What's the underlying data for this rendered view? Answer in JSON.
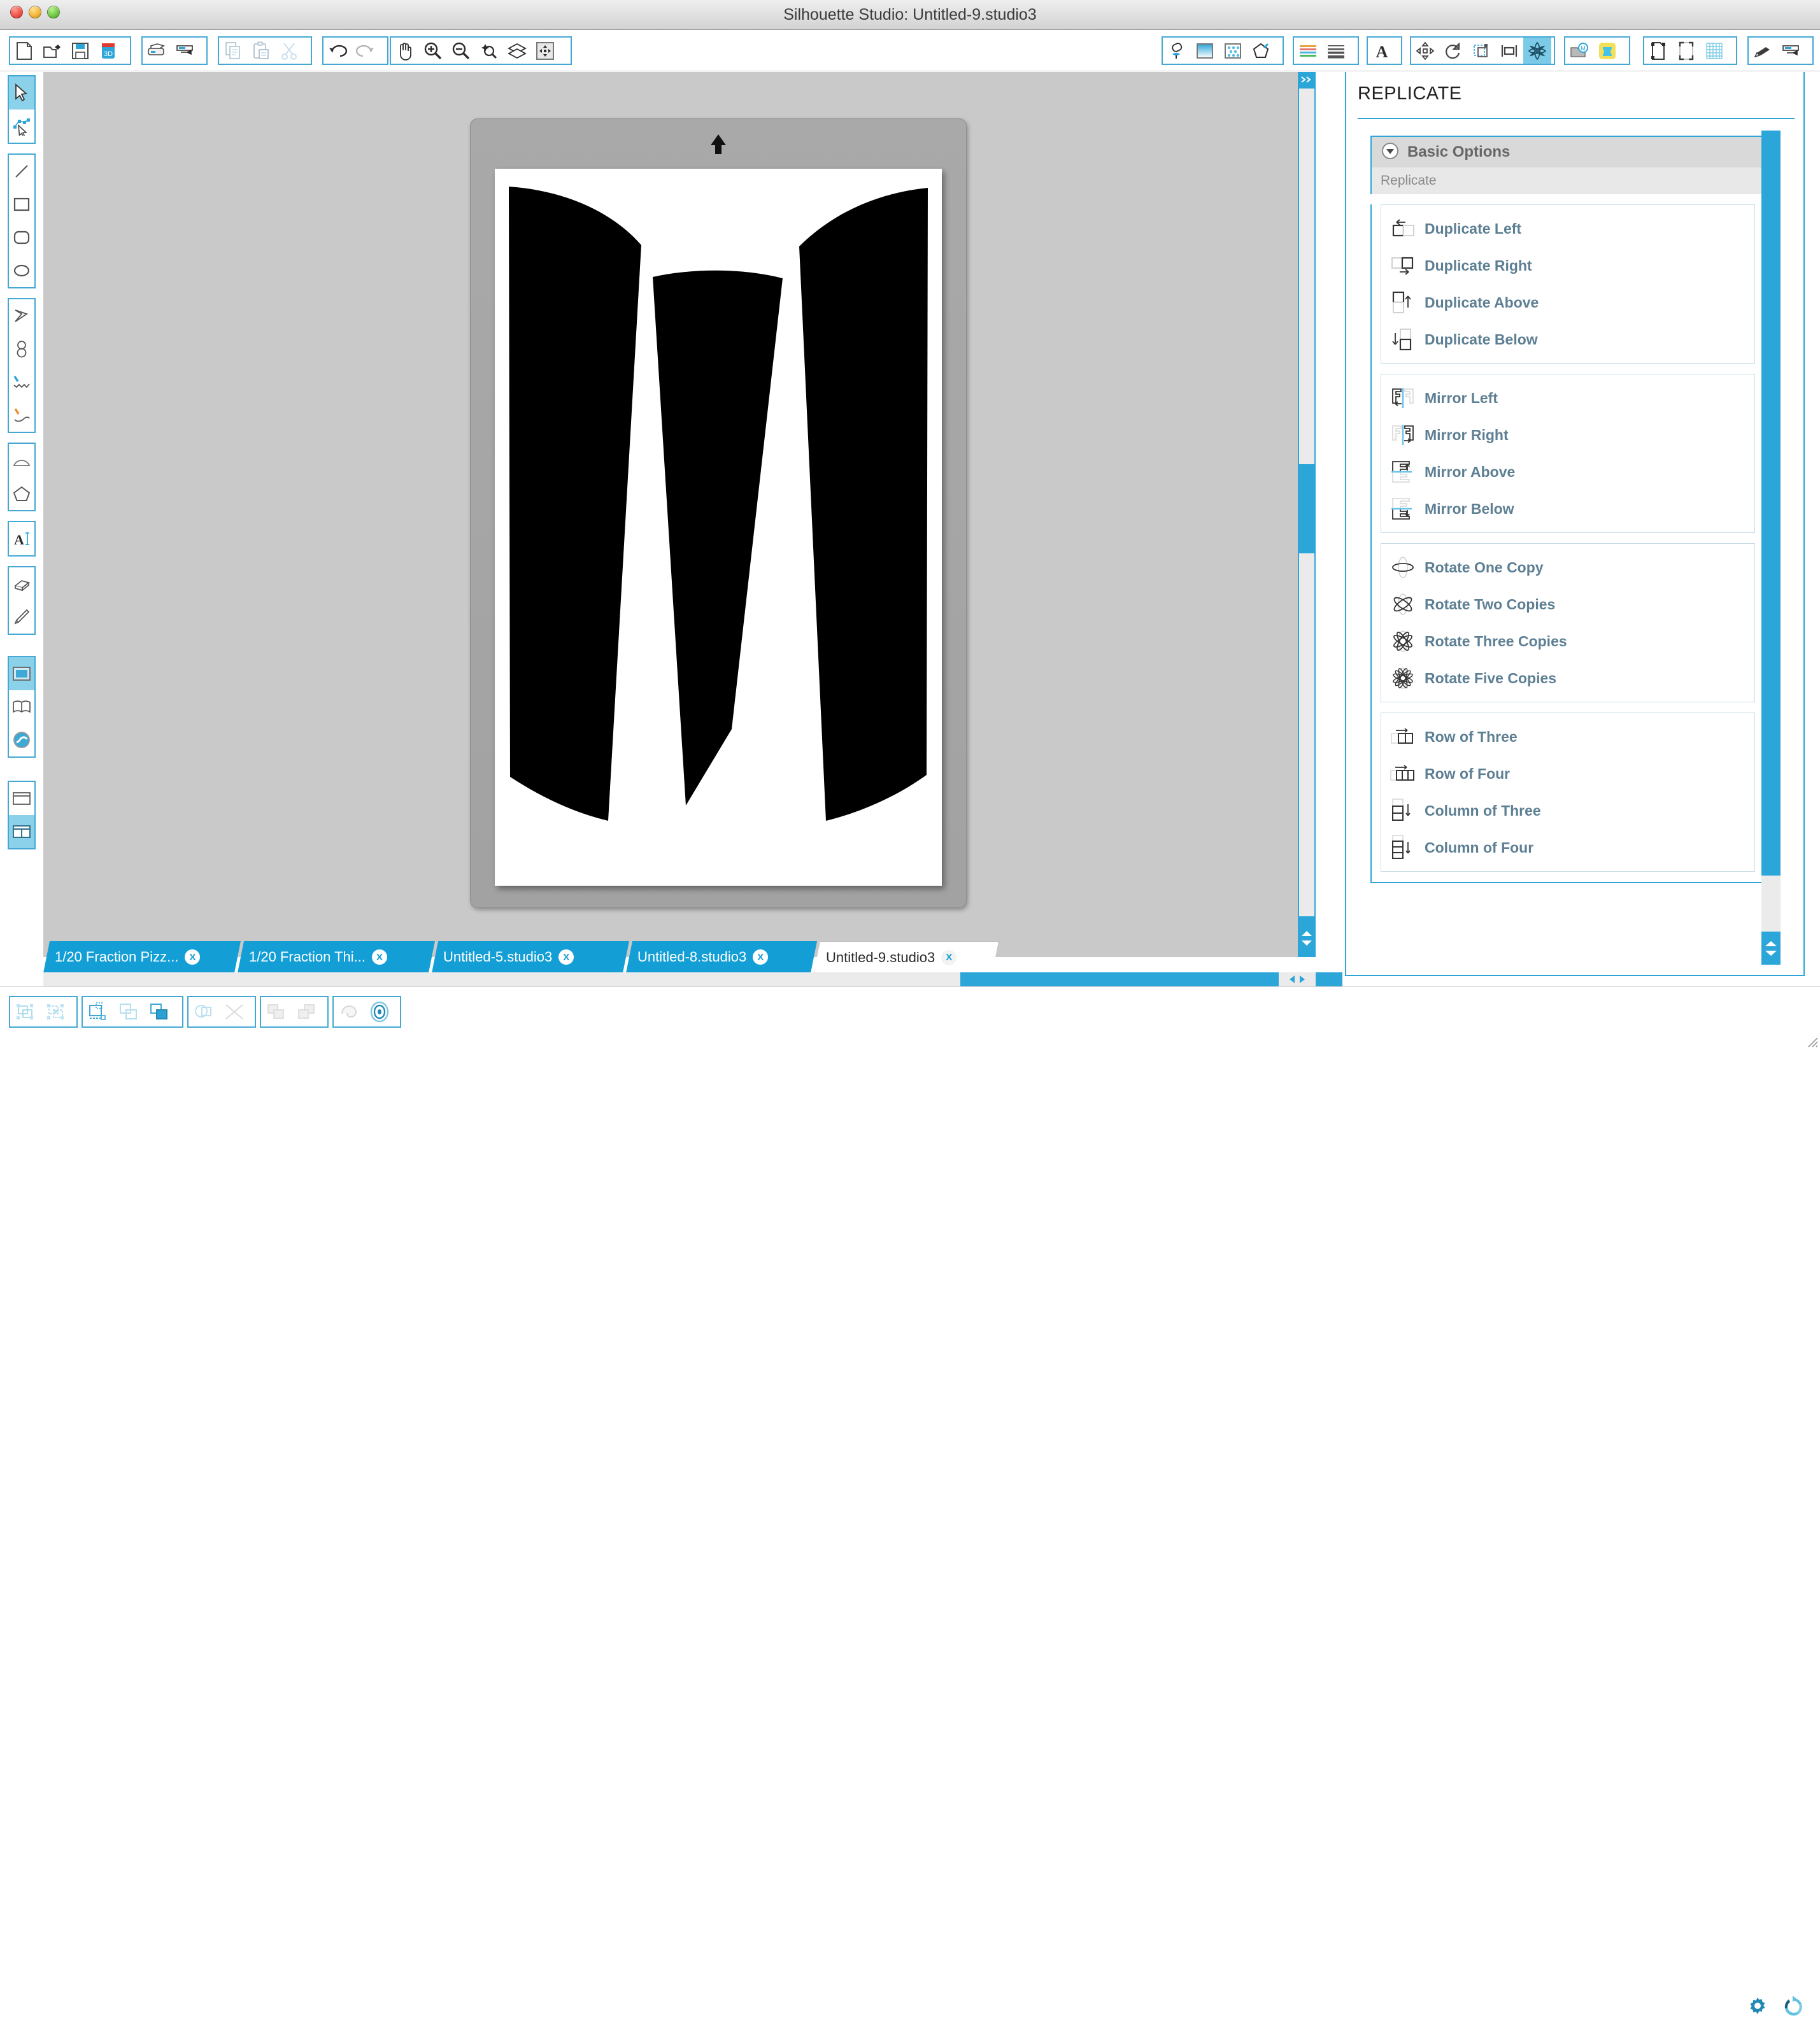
{
  "window": {
    "title": "Silhouette Studio: Untitled-9.studio3",
    "controls": [
      "close",
      "minimize",
      "maximize"
    ]
  },
  "toolbar": {
    "groups": [
      {
        "name": "file",
        "buttons": [
          {
            "icon": "new-document-icon",
            "label": "New"
          },
          {
            "icon": "open-folder-icon",
            "label": "Open"
          },
          {
            "icon": "save-floppy-icon",
            "label": "Save"
          },
          {
            "icon": "save-to-library-icon",
            "label": "Save to Library"
          }
        ]
      },
      {
        "name": "print",
        "buttons": [
          {
            "icon": "printer-icon",
            "label": "Print"
          },
          {
            "icon": "send-to-silhouette-icon",
            "label": "Send to Silhouette"
          }
        ]
      },
      {
        "name": "clipboard",
        "buttons": [
          {
            "icon": "copy-icon",
            "label": "Copy"
          },
          {
            "icon": "paste-icon",
            "label": "Paste"
          },
          {
            "icon": "cut-scissors-icon",
            "label": "Cut"
          }
        ]
      },
      {
        "name": "history",
        "buttons": [
          {
            "icon": "undo-arrow-icon",
            "label": "Undo"
          },
          {
            "icon": "redo-arrow-icon",
            "label": "Redo"
          }
        ]
      },
      {
        "name": "view",
        "buttons": [
          {
            "icon": "pan-hand-icon",
            "label": "Pan"
          },
          {
            "icon": "zoom-in-icon",
            "label": "Zoom In"
          },
          {
            "icon": "zoom-out-icon",
            "label": "Zoom Out"
          },
          {
            "icon": "zoom-selection-icon",
            "label": "Zoom to Selection"
          },
          {
            "icon": "fit-to-page-icon",
            "label": "Fit to Page"
          },
          {
            "icon": "fit-to-window-icon",
            "label": "Fit to Window"
          }
        ]
      }
    ],
    "right_groups": [
      {
        "name": "style",
        "buttons": [
          {
            "icon": "fill-color-icon",
            "label": "Fill Color"
          },
          {
            "icon": "gradient-fill-icon",
            "label": "Gradient Fill"
          },
          {
            "icon": "pattern-fill-icon",
            "label": "Pattern Fill"
          },
          {
            "icon": "line-color-icon",
            "label": "Line Color"
          }
        ]
      },
      {
        "name": "lines",
        "buttons": [
          {
            "icon": "line-style-icon",
            "label": "Line Style"
          },
          {
            "icon": "line-thickness-icon",
            "label": "Line Thickness"
          }
        ]
      },
      {
        "name": "text",
        "buttons": [
          {
            "icon": "text-style-icon",
            "label": "Text Style"
          }
        ]
      },
      {
        "name": "transform",
        "buttons": [
          {
            "icon": "move-icon",
            "label": "Move"
          },
          {
            "icon": "rotate-icon",
            "label": "Rotate"
          },
          {
            "icon": "scale-icon",
            "label": "Scale"
          },
          {
            "icon": "align-icon",
            "label": "Align"
          },
          {
            "icon": "replicate-icon",
            "label": "Replicate",
            "selected": true
          }
        ]
      },
      {
        "name": "library",
        "buttons": [
          {
            "icon": "my-library-icon",
            "label": "My Library"
          },
          {
            "icon": "store-icon",
            "label": "Silhouette Store"
          }
        ]
      },
      {
        "name": "page",
        "buttons": [
          {
            "icon": "page-setup-icon",
            "label": "Page Setup"
          },
          {
            "icon": "registration-marks-icon",
            "label": "Registration Marks"
          },
          {
            "icon": "grid-icon",
            "label": "Grid"
          }
        ]
      },
      {
        "name": "cut",
        "buttons": [
          {
            "icon": "cut-settings-icon",
            "label": "Cut Settings"
          },
          {
            "icon": "send-to-cutter-icon",
            "label": "Send to Silhouette"
          }
        ]
      }
    ]
  },
  "left_rail": {
    "groups": [
      {
        "name": "select",
        "tools": [
          {
            "icon": "select-arrow-icon",
            "label": "Select",
            "selected": true
          },
          {
            "icon": "edit-points-icon",
            "label": "Edit Points"
          }
        ]
      },
      {
        "name": "shapes",
        "tools": [
          {
            "icon": "line-tool-icon",
            "label": "Draw a Line"
          },
          {
            "icon": "rectangle-tool-icon",
            "label": "Draw a Rectangle"
          },
          {
            "icon": "rounded-rectangle-tool-icon",
            "label": "Draw a Rounded Rectangle"
          },
          {
            "icon": "ellipse-tool-icon",
            "label": "Draw an Ellipse"
          }
        ]
      },
      {
        "name": "freehand",
        "tools": [
          {
            "icon": "polygon-tool-icon",
            "label": "Draw a Polygon"
          },
          {
            "icon": "curve-shape-tool-icon",
            "label": "Draw a Curve Shape"
          },
          {
            "icon": "freehand-tool-icon",
            "label": "Draw Freehand"
          },
          {
            "icon": "smooth-freehand-tool-icon",
            "label": "Draw Smooth Freehand"
          }
        ]
      },
      {
        "name": "arc",
        "tools": [
          {
            "icon": "arc-tool-icon",
            "label": "Draw an Arc"
          },
          {
            "icon": "regular-polygon-tool-icon",
            "label": "Draw a Regular Polygon"
          }
        ]
      },
      {
        "name": "text",
        "tools": [
          {
            "icon": "text-tool-icon",
            "label": "Draw a Text Object"
          }
        ]
      },
      {
        "name": "erase",
        "tools": [
          {
            "icon": "eraser-tool-icon",
            "label": "Eraser"
          },
          {
            "icon": "knife-tool-icon",
            "label": "Knife"
          }
        ]
      },
      {
        "name": "workspace",
        "tools": [
          {
            "icon": "design-page-icon",
            "label": "Design Page",
            "selected": true
          },
          {
            "icon": "library-book-icon",
            "label": "Library"
          },
          {
            "icon": "store-globe-icon",
            "label": "Silhouette Store"
          }
        ]
      },
      {
        "name": "layout",
        "tools": [
          {
            "icon": "single-panel-icon",
            "label": "Single Panel View"
          },
          {
            "icon": "split-panel-icon",
            "label": "Split Panel View",
            "selected": true
          }
        ]
      }
    ]
  },
  "canvas": {
    "mat_orientation_icon": "up-arrow-icon",
    "artwork_name": "fraction-pie-wedges",
    "artwork_fill": "#000000",
    "page_background": "#ffffff",
    "mat_color": "#a6a6a6"
  },
  "document_tabs": [
    {
      "label": "1/20 Fraction Pizz...",
      "close": "X",
      "active": false
    },
    {
      "label": "1/20 Fraction Thi...",
      "close": "X",
      "active": false
    },
    {
      "label": "Untitled-5.studio3",
      "close": "X",
      "active": false
    },
    {
      "label": "Untitled-8.studio3",
      "close": "X",
      "active": false
    },
    {
      "label": "Untitled-9.studio3",
      "close": "X",
      "active": true
    }
  ],
  "panel": {
    "title": "REPLICATE",
    "section": {
      "label": "Basic Options",
      "collapse_icon": "chevron-down-circle-icon",
      "expanded": true
    },
    "subheader": "Replicate",
    "groups": [
      {
        "name": "duplicate",
        "items": [
          {
            "label": "Duplicate Left",
            "icon": "duplicate-left-icon"
          },
          {
            "label": "Duplicate Right",
            "icon": "duplicate-right-icon"
          },
          {
            "label": "Duplicate Above",
            "icon": "duplicate-above-icon"
          },
          {
            "label": "Duplicate Below",
            "icon": "duplicate-below-icon"
          }
        ]
      },
      {
        "name": "mirror",
        "items": [
          {
            "label": "Mirror Left",
            "icon": "mirror-left-icon"
          },
          {
            "label": "Mirror Right",
            "icon": "mirror-right-icon"
          },
          {
            "label": "Mirror Above",
            "icon": "mirror-above-icon"
          },
          {
            "label": "Mirror Below",
            "icon": "mirror-below-icon"
          }
        ]
      },
      {
        "name": "rotate",
        "items": [
          {
            "label": "Rotate One Copy",
            "icon": "rotate-one-copy-icon"
          },
          {
            "label": "Rotate Two Copies",
            "icon": "rotate-two-copies-icon"
          },
          {
            "label": "Rotate Three Copies",
            "icon": "rotate-three-copies-icon"
          },
          {
            "label": "Rotate Five Copies",
            "icon": "rotate-five-copies-icon"
          }
        ]
      },
      {
        "name": "rows-columns",
        "items": [
          {
            "label": "Row of Three",
            "icon": "row-of-three-icon"
          },
          {
            "label": "Row of Four",
            "icon": "row-of-four-icon"
          },
          {
            "label": "Column of Three",
            "icon": "column-of-three-icon"
          },
          {
            "label": "Column of Four",
            "icon": "column-of-four-icon"
          }
        ]
      }
    ]
  },
  "bottom_toolbar": {
    "groups": [
      {
        "name": "group",
        "buttons": [
          {
            "icon": "group-icon",
            "label": "Group"
          },
          {
            "icon": "ungroup-icon",
            "label": "Ungroup"
          }
        ]
      },
      {
        "name": "compound",
        "buttons": [
          {
            "icon": "make-compound-path-icon",
            "label": "Make Compound Path"
          },
          {
            "icon": "release-compound-path-icon",
            "label": "Release Compound Path"
          },
          {
            "icon": "weld-icon",
            "label": "Weld"
          }
        ]
      },
      {
        "name": "modify",
        "buttons": [
          {
            "icon": "intersect-icon",
            "label": "Intersect"
          },
          {
            "icon": "subtract-icon",
            "label": "Subtract"
          }
        ]
      },
      {
        "name": "arrange",
        "buttons": [
          {
            "icon": "bring-to-front-icon",
            "label": "Bring to Front"
          },
          {
            "icon": "send-to-back-icon",
            "label": "Send to Back"
          }
        ]
      },
      {
        "name": "trace",
        "buttons": [
          {
            "icon": "trace-icon",
            "label": "Trace"
          },
          {
            "icon": "offset-icon",
            "label": "Offset"
          }
        ]
      }
    ]
  },
  "status_bar": {
    "right_icons": [
      {
        "icon": "settings-gear-icon",
        "label": "Preferences"
      },
      {
        "icon": "sync-refresh-icon",
        "label": "Sync"
      }
    ]
  },
  "colors": {
    "accent_blue": "#2ca6d9",
    "toolbar_border": "#45a8d4",
    "panel_label": "#5d7f93",
    "tab_blue": "#139fd6",
    "canvas_gray": "#c9c9c9",
    "mat_gray": "#a6a6a6"
  }
}
